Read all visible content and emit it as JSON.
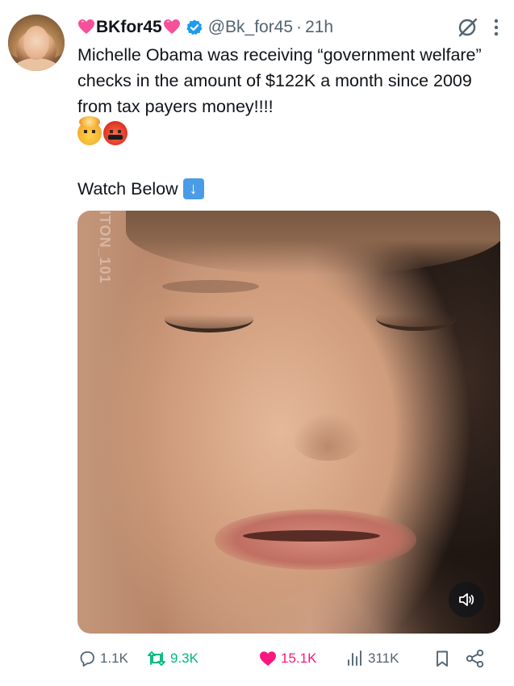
{
  "tweet": {
    "display_name": "BKfor45",
    "handle": "@Bk_for45",
    "separator": "·",
    "time": "21h",
    "text": "Michelle Obama was receiving “government welfare” checks in the amount of $122K a month since 2009 from tax payers money!!!!",
    "watch_text": "Watch Below",
    "emojis": [
      "exploding-head",
      "face-with-symbols-on-mouth"
    ],
    "watermark": "ITON_101"
  },
  "actions": {
    "replies": "1.1K",
    "reposts": "9.3K",
    "likes": "15.1K",
    "views": "311K"
  },
  "colors": {
    "text": "#0f1419",
    "secondary": "#536471",
    "verified": "#1d9bf0",
    "repost_active": "#00ba7c",
    "like_active": "#f91880",
    "heart_emoji": "#f6509a"
  },
  "icons": [
    "heart-emoji-icon",
    "verified-badge-icon",
    "grok-icon",
    "more-icon",
    "down-arrow-emoji-icon",
    "mute-icon",
    "reply-icon",
    "repost-icon",
    "like-icon",
    "views-icon",
    "bookmark-icon",
    "share-icon"
  ]
}
